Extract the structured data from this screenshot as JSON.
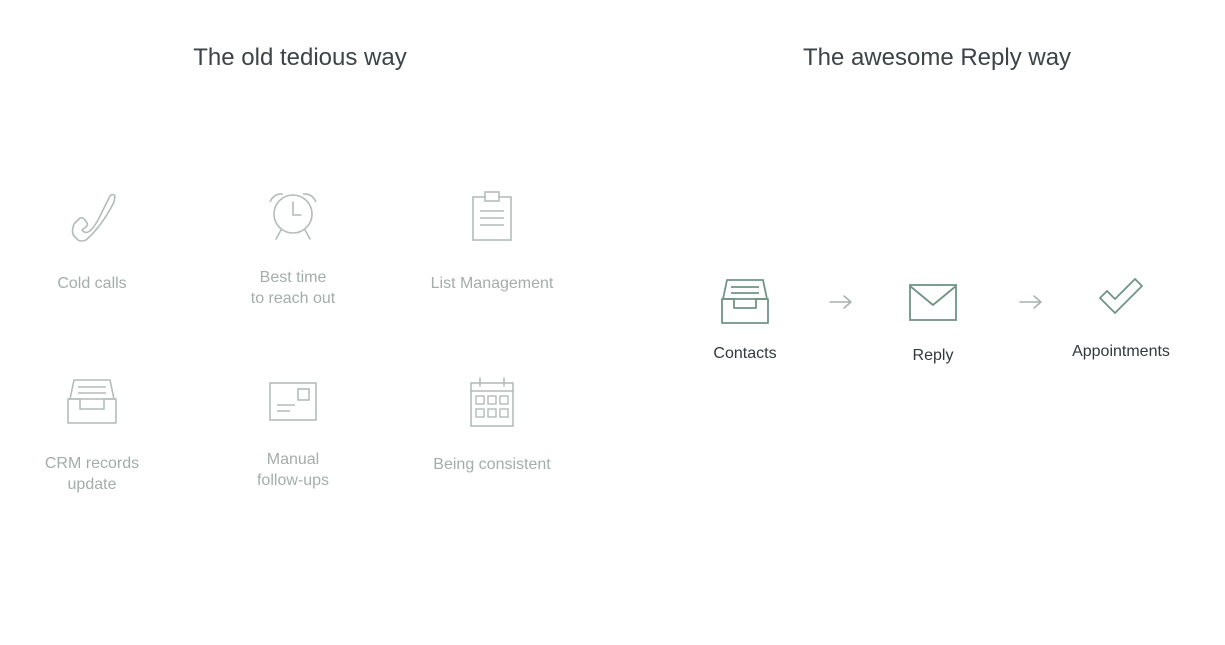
{
  "headings": {
    "old": "The old tedious way",
    "new": "The awesome Reply way"
  },
  "old_way": {
    "items": [
      {
        "icon": "phone-icon",
        "label": "Cold calls"
      },
      {
        "icon": "alarm-clock-icon",
        "label": "Best time\nto reach out"
      },
      {
        "icon": "clipboard-icon",
        "label": "List Management"
      },
      {
        "icon": "inbox-tray-icon",
        "label": "CRM records\nupdate"
      },
      {
        "icon": "postcard-icon",
        "label": "Manual\nfollow-ups"
      },
      {
        "icon": "calendar-icon",
        "label": "Being consistent"
      }
    ]
  },
  "reply_way": {
    "steps": [
      {
        "icon": "inbox-tray-icon",
        "label": "Contacts"
      },
      {
        "icon": "envelope-icon",
        "label": "Reply"
      },
      {
        "icon": "checkmark-icon",
        "label": "Appointments"
      }
    ],
    "connector": "right-arrow-icon"
  },
  "colors": {
    "heading": "#3d4346",
    "old_icon": "#b4bcb9",
    "old_label": "#a4adaa",
    "new_icon": "#6f9484",
    "new_label": "#33393b",
    "arrow": "#a9b1ae"
  }
}
